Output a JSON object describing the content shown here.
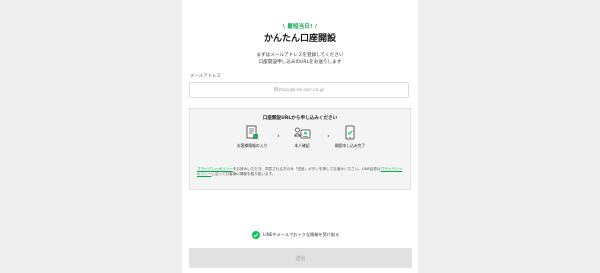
{
  "header": {
    "badge": "\\ 最短当日! /",
    "title": "かんたん口座開設",
    "subtitle_line1": "まずはメールアドレスを登録してください",
    "subtitle_line2": "口座開設申し込みのURLをお送りします"
  },
  "email": {
    "label": "メールアドレス",
    "placeholder": "例)taro@line-sec.co.jp"
  },
  "flow": {
    "title": "口座開設URLから申し込みください",
    "steps": [
      {
        "label": "お客様情報の入力",
        "icon": "document-input-icon"
      },
      {
        "label": "本人確認",
        "icon": "id-card-icon"
      },
      {
        "label": "開設申し込み完了",
        "icon": "phone-check-icon"
      }
    ],
    "arrow": "›"
  },
  "notice": {
    "part1": "プライバシーポリシー",
    "part2": "をお読みいただき、同意される方のみ「送信」ボタンを押してお進みください。LINE証券は",
    "part3": "プライバシーポリシー",
    "part4": "に沿ってお客様の情報を取り扱います。"
  },
  "optin": {
    "checked": true,
    "label": "LINEやメールでおトクな情報を受け取る"
  },
  "submit": {
    "label": "送信",
    "enabled": false
  },
  "colors": {
    "accent": "#06c755",
    "link": "#06a94d",
    "button_disabled": "#e1e1e1"
  }
}
